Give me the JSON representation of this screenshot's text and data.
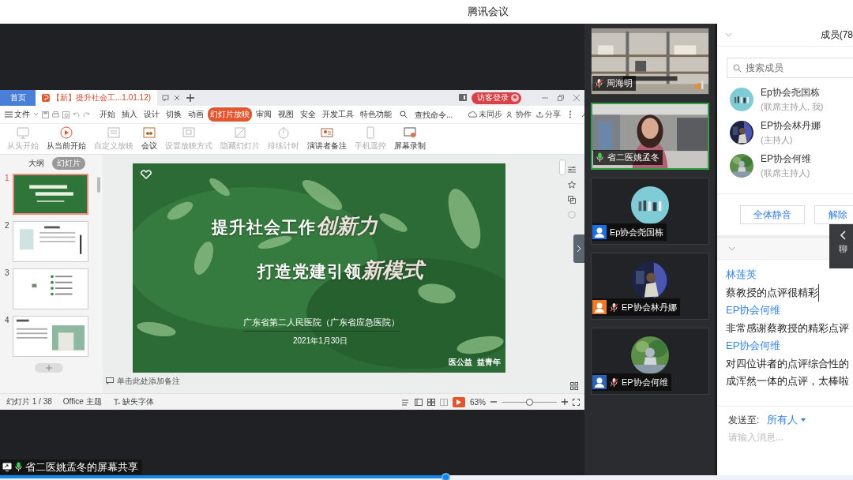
{
  "window": {
    "title": "腾讯会议"
  },
  "wps": {
    "tabs": [
      {
        "label": "首页",
        "kind": "home",
        "selected": false
      },
      {
        "label": "【新】提升社会工...1.01.12)",
        "kind": "doc",
        "selected": true
      }
    ],
    "login": "访客登录",
    "file_menu": "文件",
    "menu": [
      {
        "label": "开始",
        "selected": false
      },
      {
        "label": "插入",
        "selected": false
      },
      {
        "label": "设计",
        "selected": false
      },
      {
        "label": "切换",
        "selected": false
      },
      {
        "label": "动画",
        "selected": false
      },
      {
        "label": "幻灯片放映",
        "selected": true
      },
      {
        "label": "审阅",
        "selected": false
      },
      {
        "label": "视图",
        "selected": false
      },
      {
        "label": "安全",
        "selected": false
      },
      {
        "label": "开发工具",
        "selected": false
      },
      {
        "label": "特色功能",
        "selected": false
      }
    ],
    "command_search": {
      "placeholder": "查找命令..."
    },
    "sync": "未同步",
    "collab": "协作",
    "share": "分享",
    "ribbon": [
      {
        "label": "从头开始",
        "kind": "monitor",
        "disabled": true
      },
      {
        "label": "从当前开始",
        "kind": "play",
        "disabled": false
      },
      {
        "label": "自定义放映",
        "kind": "document",
        "disabled": true
      },
      {
        "label": "会议",
        "kind": "people",
        "disabled": false
      },
      {
        "label": "设置放映方式",
        "kind": "screen",
        "disabled": true
      },
      {
        "label": "隐藏幻灯片",
        "kind": "slide",
        "disabled": true
      },
      {
        "label": "排练计时",
        "kind": "stopwatch",
        "disabled": true
      },
      {
        "label": "演讲者备注",
        "kind": "presenter",
        "disabled": false
      },
      {
        "label": "手机遥控",
        "kind": "phone",
        "disabled": true
      },
      {
        "label": "屏幕录制",
        "kind": "record",
        "disabled": false
      }
    ],
    "panel_tabs": [
      {
        "label": "大纲",
        "selected": false
      },
      {
        "label": "幻灯片",
        "selected": true
      }
    ],
    "thumbnails": [
      {
        "number": "1",
        "kind": "title",
        "selected": true
      },
      {
        "number": "2",
        "kind": "profile",
        "selected": false
      },
      {
        "number": "3",
        "kind": "list",
        "selected": false
      },
      {
        "number": "4",
        "selected": false
      }
    ],
    "slide": {
      "line1": "提升社会工作",
      "line1_emphasis": "创新力",
      "line2": "打造党建引领",
      "line2_emphasis": "新模式",
      "hospital": "广东省第二人民医院（广东省应急医院）",
      "date": "2021年1月30日",
      "slogan": "医公益  益青年"
    },
    "notes": {
      "placeholder": "单击此处添加备注"
    },
    "status": {
      "slide_count": "幻灯片 1 / 38",
      "theme": "Office 主题",
      "missing_fonts": "缺失字体",
      "zoom": "63%"
    },
    "zoom_slider": {
      "level": 0.5
    }
  },
  "share_label": "省二医姚孟冬的屏幕共享",
  "videos": [
    {
      "name": "周海明",
      "kind": "office",
      "mic": {
        "muted": true
      },
      "volume": true,
      "speaking": false
    },
    {
      "name": "省二医姚孟冬",
      "kind": "room",
      "mic": {
        "muted": false
      },
      "volume": false,
      "speaking": true
    },
    {
      "name": "Ep协会尧国栋",
      "kind": "avatar",
      "avatar": {
        "kind": "group"
      },
      "color": "#1f6fe0",
      "volume": false,
      "speaking": false
    },
    {
      "name": "EP协会林丹娜",
      "kind": "avatar",
      "avatar": {
        "kind": "night"
      },
      "color": "#f07a20",
      "mic": {
        "muted": true
      },
      "volume": false,
      "speaking": false
    },
    {
      "name": "EP协会何维",
      "kind": "avatar",
      "avatar": {
        "kind": "garden"
      },
      "color": "#2a63b8",
      "mic": {
        "muted": true
      },
      "volume": false,
      "speaking": false
    }
  ],
  "members": {
    "title": "成员(78",
    "search": {
      "placeholder": "搜索成员"
    },
    "list": [
      {
        "name": "Ep协会尧国栋",
        "role": "(联席主持人, 我)",
        "avatar": {
          "kind": "group"
        }
      },
      {
        "name": "EP协会林丹娜",
        "role": "(主持人)",
        "avatar": {
          "kind": "night"
        }
      },
      {
        "name": "EP协会何维",
        "role": "(联席主持人)",
        "avatar": {
          "kind": "garden"
        }
      }
    ],
    "buttons": [
      "全体静音",
      "解除"
    ]
  },
  "chat": {
    "tab": "聊",
    "messages": [
      {
        "sender": "林莲英",
        "lines": [
          "蔡教授的点评很精彩"
        ]
      },
      {
        "sender": "EP协会何维",
        "lines": [
          "非常感谢蔡教授的精彩点评"
        ]
      },
      {
        "sender": "EP协会何维",
        "lines": [
          "对四位讲者的点评综合性的",
          "成浑然一体的点评，太棒啦"
        ]
      }
    ],
    "send_to_label": "发送至:",
    "recipient": "所有人",
    "input": {
      "placeholder": "请输入消息..."
    }
  },
  "playback": {
    "level": 0.523
  }
}
